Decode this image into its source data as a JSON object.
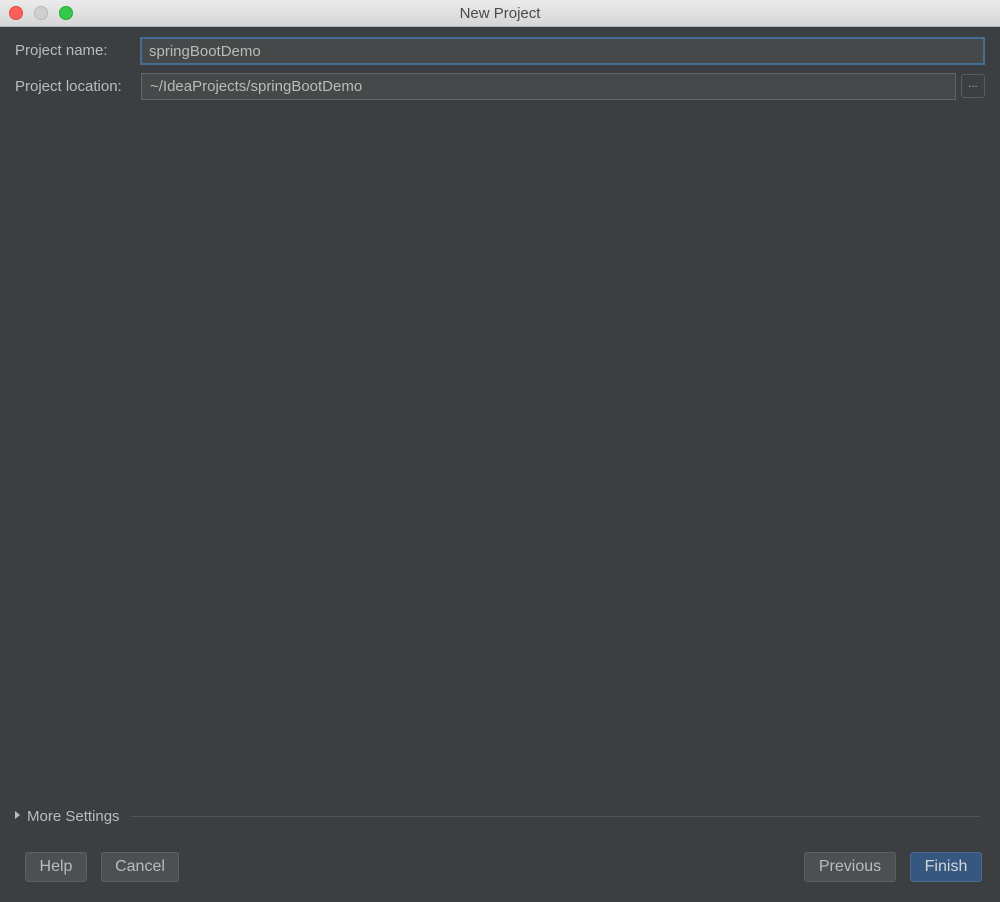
{
  "window": {
    "title": "New Project",
    "controls": {
      "close": "close-icon",
      "minimize": "minimize-icon",
      "maximize": "maximize-icon"
    }
  },
  "form": {
    "project_name_label": "Project name:",
    "project_name_value": "springBootDemo",
    "project_location_label": "Project location:",
    "project_location_value": "~/IdeaProjects/springBootDemo",
    "browse_label": "..."
  },
  "more_settings": {
    "label": "More Settings",
    "expanded": false
  },
  "buttons": {
    "help": "Help",
    "cancel": "Cancel",
    "previous": "Previous",
    "finish": "Finish"
  },
  "colors": {
    "accent": "#365880",
    "focus_border": "#466d94",
    "background": "#3c3f41"
  }
}
